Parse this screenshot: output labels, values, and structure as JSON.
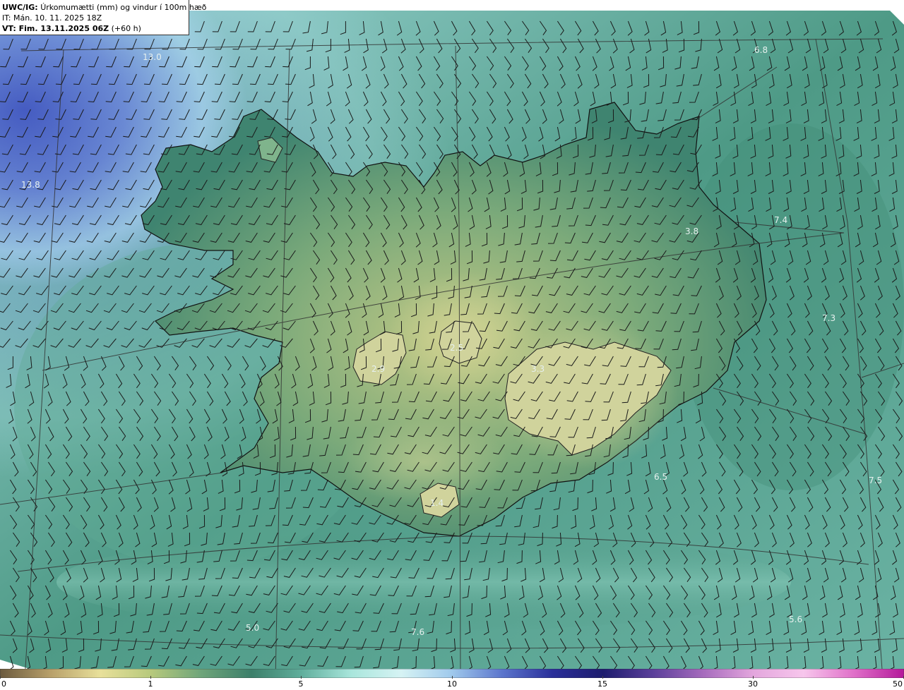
{
  "header": {
    "model": "UWC/IG:",
    "title": "Úrkomumætti (mm) og vindur í 100m hæð",
    "it_line": "IT: Mán. 10. 11. 2025 18Z",
    "vt_prefix": "VT: Fim. 13.11.2025 06Z",
    "vt_suffix": "(+60 h)"
  },
  "map_labels": [
    "13.0",
    "13.8",
    "6.8",
    "7.4",
    "3.8",
    "7.3",
    "2.5",
    "2.9",
    "3.3",
    "6.5",
    "7.5",
    "1.4",
    "5.0",
    "7.6",
    "5.6"
  ],
  "colorbar": {
    "ticks": [
      "0",
      "1",
      "5",
      "10",
      "15",
      "30",
      "50"
    ],
    "tick_values": [
      0,
      1,
      5,
      10,
      15,
      30,
      50
    ],
    "colors": [
      "#6b5a3e",
      "#b8a06a",
      "#e8e09a",
      "#b7c97c",
      "#6fa57a",
      "#3c7f6a",
      "#5fae9c",
      "#a9e6dc",
      "#d6f3f4",
      "#9fc9ec",
      "#5a74cc",
      "#2a2f9a",
      "#1d1c6e",
      "#5a3f9a",
      "#a66bbd",
      "#e3a6dd",
      "#f7c6ec",
      "#e070c9",
      "#b4199a"
    ]
  },
  "legend_colors": {
    "sea_blue": "#4d63c4",
    "land_green": "#4e8a6e",
    "high_yellow": "#c9cf86",
    "coast_line": "#111111",
    "barb_color": "#1a1a1a"
  }
}
